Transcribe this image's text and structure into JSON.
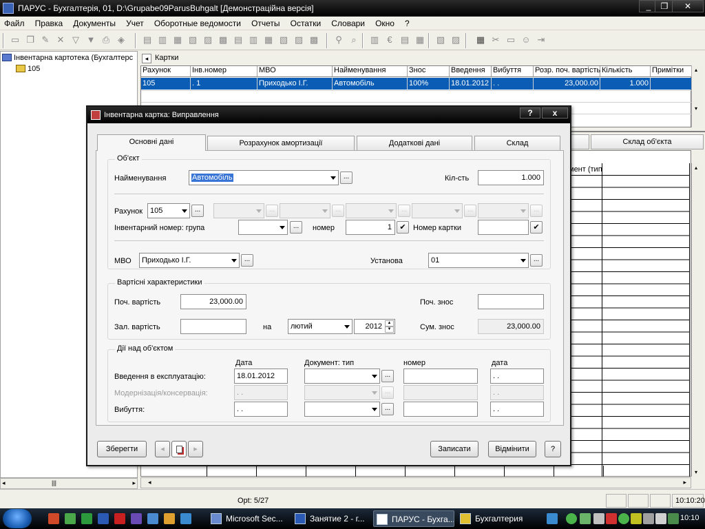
{
  "app": {
    "title": "ПАРУС - Бухгалтерія, 01, D:\\Grupabe09ParusBuhgalt [Демонстраційна версія]",
    "menu": [
      "Файл",
      "Правка",
      "Документы",
      "Учет",
      "Оборотные ведомости",
      "Отчеты",
      "Остатки",
      "Словари",
      "Окно",
      "?"
    ]
  },
  "tree": {
    "root": "Інвентарна картотека (Бухгалтерс",
    "child": "105"
  },
  "cards": {
    "title": "Картки",
    "columns": [
      "Рахунок",
      "Інв.номер",
      "МВО",
      "Найменування",
      "Знос",
      "Введення",
      "Вибуття",
      "Розр. поч. вартість",
      "Кількість",
      "Примітки"
    ],
    "row": [
      "105",
      ".     1",
      "Приходько І.Г.",
      "Автомобіль",
      "100%",
      "18.01.2012",
      ". .",
      "23,000.00",
      "1.000",
      ""
    ]
  },
  "bottom_tabs": {
    "composition": "Склад об'єкта",
    "col_partial": "мент (тип"
  },
  "statusbar": {
    "record": "Орt: 5/27",
    "time": "10:10:20"
  },
  "taskbar": {
    "items": [
      "Microsoft Sec...",
      "Занятие 2 - г...",
      "ПАРУС - Бухга...",
      "Бухгалтерия"
    ],
    "clock": "10:10"
  },
  "dialog": {
    "title": "Інвентарна картка: Виправлення",
    "help_btn": "?",
    "close_btn": "x",
    "tabs": [
      "Основні дані",
      "Розрахунок амортизації",
      "Додаткові дані",
      "Склад"
    ],
    "object_group": "Об'єкт",
    "name_label": "Найменування",
    "name_value": "Автомобіль",
    "qty_label": "Кіл-сть",
    "qty_value": "1.000",
    "account_label": "Рахунок",
    "account_value": "105",
    "inv_group_label": "Інвентарний номер: група",
    "number_label": "номер",
    "number_value": "1",
    "card_no_label": "Номер картки",
    "mvo_label": "МВО",
    "mvo_value": "Приходько І.Г.",
    "institution_label": "Установа",
    "institution_value": "01",
    "cost_group": "Вартісні характеристики",
    "init_cost_label": "Поч. вартість",
    "init_cost_value": "23,000.00",
    "init_wear_label": "Поч. знос",
    "resid_cost_label": "Зал. вартість",
    "on_label": "на",
    "month_value": "лютий",
    "year_value": "2012",
    "sum_wear_label": "Сум. знос",
    "sum_wear_value": "23,000.00",
    "actions_group": "Дії над об'єктом",
    "col_date": "Дата",
    "col_doc": "Документ:  тип",
    "col_num": "номер",
    "col_date2": "дата",
    "commission_label": "Введення в експлуатацію:",
    "commission_date": "18.01.2012",
    "modernization_label": "Модернізація/консервація:",
    "disposal_label": "Вибуття:",
    "empty_date": ".  .",
    "save_btn": "Зберегти",
    "write_btn": "Записати",
    "cancel_btn": "Відмінити",
    "help2_btn": "?"
  }
}
